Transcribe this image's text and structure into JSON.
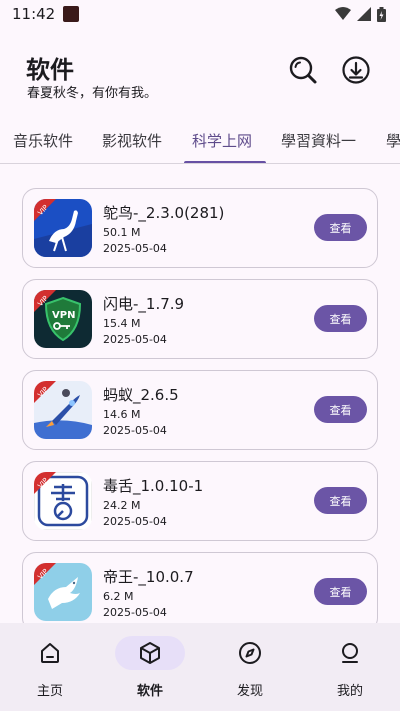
{
  "status_bar": {
    "time": "11:42"
  },
  "header": {
    "title": "软件",
    "subtitle": "春夏秋冬，有你有我。"
  },
  "tabs": [
    {
      "label": "音乐软件",
      "active": false
    },
    {
      "label": "影视软件",
      "active": false
    },
    {
      "label": "科学上网",
      "active": true
    },
    {
      "label": "學習資料一",
      "active": false
    },
    {
      "label": "學",
      "active": false
    }
  ],
  "apps": [
    {
      "name": "鸵鸟-_2.3.0(281)",
      "size": "50.1 M",
      "date": "2025-05-04",
      "button": "查看",
      "icon": "ostrich-icon",
      "badge": "VIP"
    },
    {
      "name": "闪电-_1.7.9",
      "size": "15.4 M",
      "date": "2025-05-04",
      "button": "查看",
      "icon": "vpn-shield-icon",
      "badge": "VIP"
    },
    {
      "name": "蚂蚁_2.6.5",
      "size": "14.6 M",
      "date": "2025-05-04",
      "button": "查看",
      "icon": "rocket-icon",
      "badge": "VIP"
    },
    {
      "name": "毒舌_1.0.10-1",
      "size": "24.2 M",
      "date": "2025-05-04",
      "button": "查看",
      "icon": "duoshe-icon",
      "badge": "VIP"
    },
    {
      "name": "帝王-_10.0.7",
      "size": "6.2 M",
      "date": "2025-05-04",
      "button": "查看",
      "icon": "dove-icon",
      "badge": "VIP"
    }
  ],
  "bottom_nav": [
    {
      "label": "主页",
      "icon": "home-icon",
      "active": false
    },
    {
      "label": "软件",
      "icon": "cube-icon",
      "active": true
    },
    {
      "label": "发现",
      "icon": "compass-icon",
      "active": false
    },
    {
      "label": "我的",
      "icon": "profile-icon",
      "active": false
    }
  ],
  "colors": {
    "accent": "#6750a4",
    "button": "#6b55a6",
    "background": "#fdf7fd",
    "nav_background": "#f2ecf4",
    "vip_badge": "#d32f2f"
  }
}
